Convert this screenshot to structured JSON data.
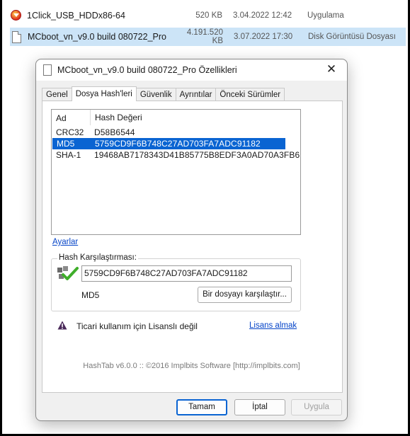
{
  "explorer": {
    "rows": [
      {
        "name": "1Click_USB_HDDx86-64",
        "size": "520 KB",
        "date": "3.04.2022 12:42",
        "type": "Uygulama",
        "icon": "app-icon"
      },
      {
        "name": "MCboot_vn_v9.0 build 080722_Pro",
        "size": "4.191.520 KB",
        "date": "3.07.2022 17:30",
        "type": "Disk Görüntüsü Dosyası",
        "icon": "disk-image-icon"
      }
    ],
    "selected_color": "#cce4f7"
  },
  "dialog": {
    "title": "MCboot_vn_v9.0 build 080722_Pro Özellikleri",
    "close": "✕",
    "tabs": [
      "Genel",
      "Dosya Hash'leri",
      "Güvenlik",
      "Ayrıntılar",
      "Önceki Sürümler"
    ],
    "active_tab": "Dosya Hash'leri",
    "hash_list": {
      "headers": [
        "Ad",
        "Hash Değeri"
      ],
      "rows": [
        {
          "name": "CRC32",
          "value": "D58B6544"
        },
        {
          "name": "MD5",
          "value": "5759CD9F6B748C27AD703FA7ADC91182"
        },
        {
          "name": "SHA-1",
          "value": "19468AB7178343D41B85775B8EDF3A0AD70A3FB6"
        }
      ],
      "selected_index": 1,
      "selected_color": "#0a64d2"
    },
    "settings_link": "Ayarlar",
    "compare": {
      "group_label": "Hash Karşılaştırması:",
      "input_value": "5759CD9F6B748C27AD703FA7ADC91182",
      "algorithm": "MD5",
      "button": "Bir dosyayı karşılaştır..."
    },
    "license": {
      "text": "Ticari kullanım için Lisanslı değil",
      "link": "Lisans almak"
    },
    "footer": "HashTab v6.0.0 :: ©2016 Implbits Software [http://implbits.com]",
    "buttons": {
      "ok": "Tamam",
      "cancel": "İptal",
      "apply": "Uygula"
    }
  }
}
